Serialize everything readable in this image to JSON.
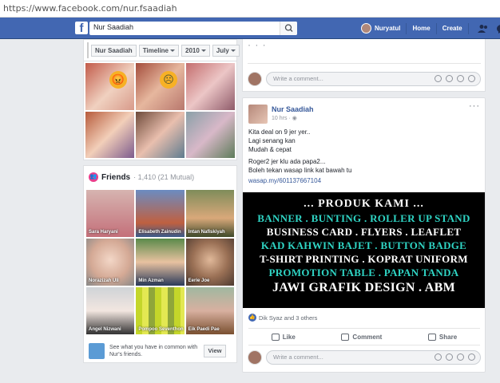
{
  "browser": {
    "url": "https://www.facebook.com/nur.fsaadiah"
  },
  "topnav": {
    "search_value": "Nur Saadiah",
    "user_name": "Nuryatul",
    "home_label": "Home",
    "create_label": "Create",
    "notification_count": "1",
    "bar_color": "#4267b2"
  },
  "profile_nav": {
    "name": "Nur Saadiah",
    "timeline_label": "Timeline",
    "year_label": "2010",
    "month_label": "July"
  },
  "friends": {
    "title": "Friends",
    "count_text": "· 1,410 (21 Mutual)",
    "items": [
      {
        "name": "Sara Haryani"
      },
      {
        "name": "Elisabeth Zainudin"
      },
      {
        "name": "Intan Nafiskiyah"
      },
      {
        "name": "Norazizah Uli"
      },
      {
        "name": "Min Azman"
      },
      {
        "name": "Eerie Joe"
      },
      {
        "name": "Angel Nizwani"
      },
      {
        "name": "Pompoo Seventhon"
      },
      {
        "name": "Eik Paedi Pae"
      }
    ],
    "footer_text": "See what you have in common with Nur's friends.",
    "view_label": "View"
  },
  "comment_placeholder": "Write a comment...",
  "post": {
    "author": "Nur Saadiah",
    "time": "10 hrs ·",
    "body_lines": [
      "Kita deal on 9 jer yer..",
      "Lagi senang kan",
      "Mudah & cepat"
    ],
    "body_lines2": [
      "Roger2 jer klu ada papa2...",
      "Boleh tekan wasap link kat bawah tu"
    ],
    "link": "wasap.my/601137667104",
    "banner": {
      "title": "... PRODUK KAMI ...",
      "lines": [
        "BANNER . BUNTING . ROLLER UP STAND",
        "BUSINESS CARD . FLYERS . LEAFLET",
        "KAD KAHWIN BAJET . BUTTON BADGE",
        "T-SHIRT PRINTING . KOPRAT UNIFORM",
        "PROMOTION TABLE . PAPAN TANDA",
        "JAWI GRAFIK DESIGN . ABM"
      ]
    },
    "reactions_text": "Dik Syaz and 3 others",
    "like_label": "Like",
    "comment_label": "Comment",
    "share_label": "Share"
  }
}
